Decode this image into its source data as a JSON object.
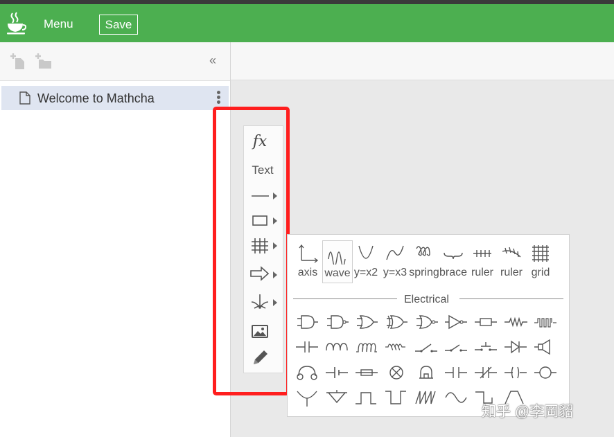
{
  "topbar": {
    "menu_label": "Menu",
    "save_label": "Save",
    "color": "#4caf50"
  },
  "sidebar": {
    "collapse_icon": "«",
    "document_title": "Welcome to Mathcha"
  },
  "toolbar": {
    "fx_label": "fx",
    "text_label": "Text"
  },
  "shapes_panel": {
    "items": [
      "axis",
      "wave",
      "y=x2",
      "y=x3",
      "spring",
      "brace",
      "ruler",
      "ruler",
      "grid"
    ],
    "section_label": "Electrical"
  },
  "highlight_color": "#ff1e1e",
  "watermark": "知乎 @李岡貂"
}
